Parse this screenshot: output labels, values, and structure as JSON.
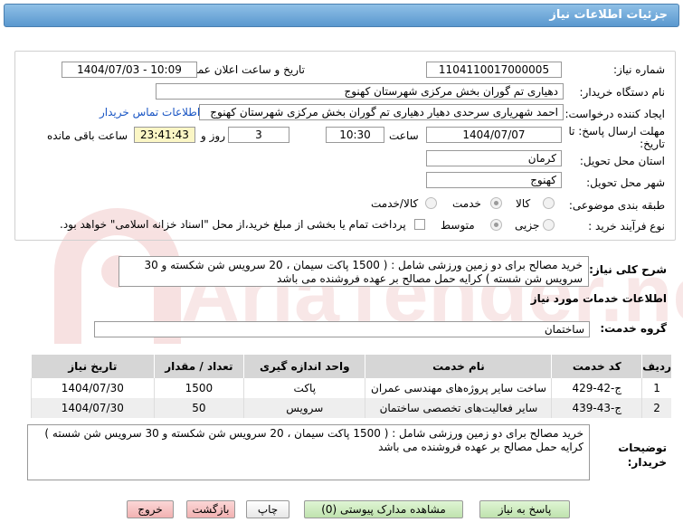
{
  "header": {
    "title": "جزئیات اطلاعات نیاز"
  },
  "fields": {
    "need_number_label": "شماره نیاز:",
    "need_number": "1104110017000005",
    "announce_label": "تاریخ و ساعت اعلان عمومی:",
    "announce_value": "1404/07/03 - 10:09",
    "buyer_org_label": "نام دستگاه خریدار:",
    "buyer_org": "دهیاری تم گوران بخش مرکزی شهرستان کهنوج",
    "creator_label": "ایجاد کننده درخواست:",
    "creator": "احمد شهریاری سرحدی دهیار دهیاری تم گوران بخش مرکزی شهرستان کهنوج",
    "contact_link": "اطلاعات تماس خریدار",
    "deadline_label_1": "مهلت ارسال پاسخ: تا",
    "deadline_label_2": "تاریخ:",
    "deadline_date": "1404/07/07",
    "time_label": "ساعت",
    "deadline_time": "10:30",
    "days": "3",
    "days_label": "روز و",
    "remaining_time": "23:41:43",
    "remaining_label": "ساعت باقی مانده",
    "province_label": "استان محل تحویل:",
    "province": "کرمان",
    "city_label": "شهر محل تحویل:",
    "city": "کهنوج",
    "category_label": "طبقه بندی موضوعی:",
    "category_options": [
      "کالا",
      "خدمت",
      "کالا/خدمت"
    ],
    "process_label": "نوع فرآیند خرید :",
    "process_options": [
      "جزیی",
      "متوسط"
    ],
    "payment_note": "پرداخت تمام یا بخشی از مبلغ خرید،از محل \"اسناد خزانه اسلامی\" خواهد بود."
  },
  "description": {
    "label": "شرح کلی نیاز:",
    "text": "خرید مصالح برای دو زمین ورزشی شامل : ( 1500 پاکت سیمان ، 20 سرویس شن شکسته و 30 سرویس شن شسته ) کرایه حمل مصالح  بر عهده  فروشنده می باشد"
  },
  "services": {
    "title": "اطلاعات خدمات مورد نیاز",
    "group_label": "گروه خدمت:",
    "group_value": "ساختمان",
    "columns": [
      "ردیف",
      "کد خدمت",
      "نام خدمت",
      "واحد اندازه گیری",
      "تعداد / مقدار",
      "تاریخ نیاز"
    ],
    "rows": [
      {
        "row": "1",
        "code": "ج-42-429",
        "name": "ساخت سایر پروژه‌های مهندسی عمران",
        "unit": "پاکت",
        "qty": "1500",
        "date": "1404/07/30"
      },
      {
        "row": "2",
        "code": "ج-43-439",
        "name": "سایر فعالیت‌های تخصصی ساختمان",
        "unit": "سرویس",
        "qty": "50",
        "date": "1404/07/30"
      }
    ]
  },
  "buyer_notes": {
    "label_1": "توضیحات",
    "label_2": "خریدار:",
    "text": "خرید مصالح برای دو زمین ورزشی شامل : ( 1500 پاکت سیمان ، 20 سرویس شن شکسته و 30 سرویس شن شسته ) کرایه حمل مصالح  بر عهده  فروشنده می باشد"
  },
  "buttons": {
    "reply": "پاسخ به نیاز",
    "documents": "مشاهده مدارک پیوستی (0)",
    "print": "چاپ",
    "back": "بازگشت",
    "exit": "خروج"
  },
  "watermark": {
    "text": "AriaTender.net"
  }
}
